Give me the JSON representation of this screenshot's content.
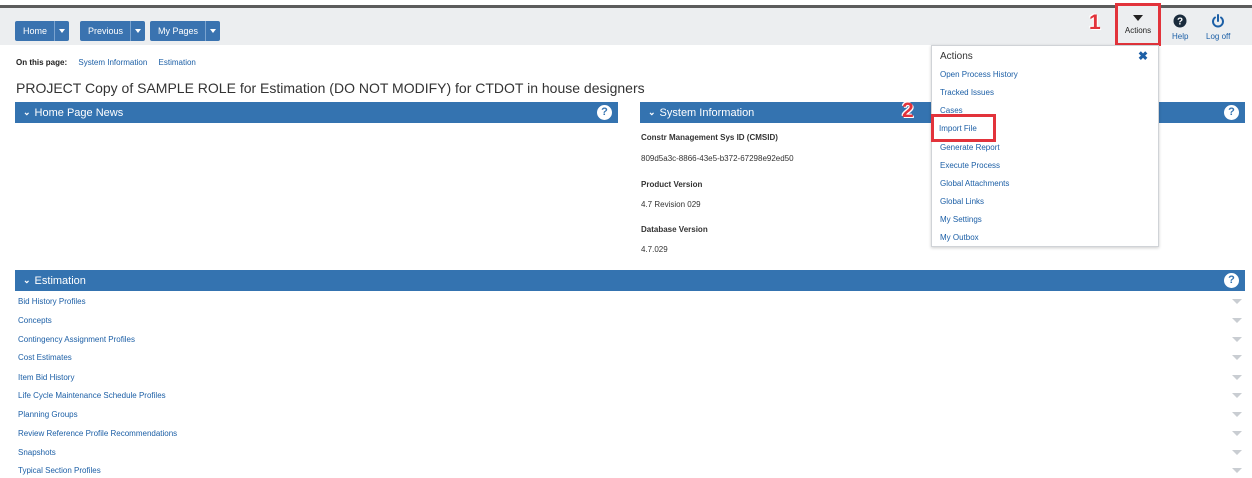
{
  "nav": {
    "home": "Home",
    "previous": "Previous",
    "my_pages": "My Pages"
  },
  "toolbar": {
    "actions": "Actions",
    "help": "Help",
    "logoff": "Log off"
  },
  "annotations": {
    "step1": "1",
    "step2": "2"
  },
  "on_this_page": {
    "label": "On this page:",
    "links": [
      "System Information",
      "Estimation"
    ]
  },
  "page_title": "PROJECT Copy of SAMPLE ROLE for Estimation (DO NOT MODIFY) for CTDOT in house designers",
  "panels": {
    "home_news": {
      "title": "Home Page News"
    },
    "system_info": {
      "title": "System Information",
      "fields": [
        {
          "label": "Constr Management Sys ID (CMSID)",
          "value": "809d5a3c-8866-43e5-b372-67298e92ed50"
        },
        {
          "label": "Product Version",
          "value": "4.7 Revision 029"
        },
        {
          "label": "Database Version",
          "value": "4.7.029"
        }
      ]
    },
    "estimation": {
      "title": "Estimation",
      "items": [
        "Bid History Profiles",
        "Concepts",
        "Contingency Assignment Profiles",
        "Cost Estimates",
        "Item Bid History",
        "Life Cycle Maintenance Schedule Profiles",
        "Planning Groups",
        "Review Reference Profile Recommendations",
        "Snapshots",
        "Typical Section Profiles"
      ]
    }
  },
  "actions_menu": {
    "title": "Actions",
    "items": [
      "Open Process History",
      "Tracked Issues",
      "Cases",
      "Import File",
      "Generate Report",
      "Execute Process",
      "Global Attachments",
      "Global Links",
      "My Settings",
      "My Outbox"
    ]
  },
  "colors": {
    "accent": "#3473b0",
    "link": "#1c5fa6",
    "highlight": "#e2333b"
  }
}
